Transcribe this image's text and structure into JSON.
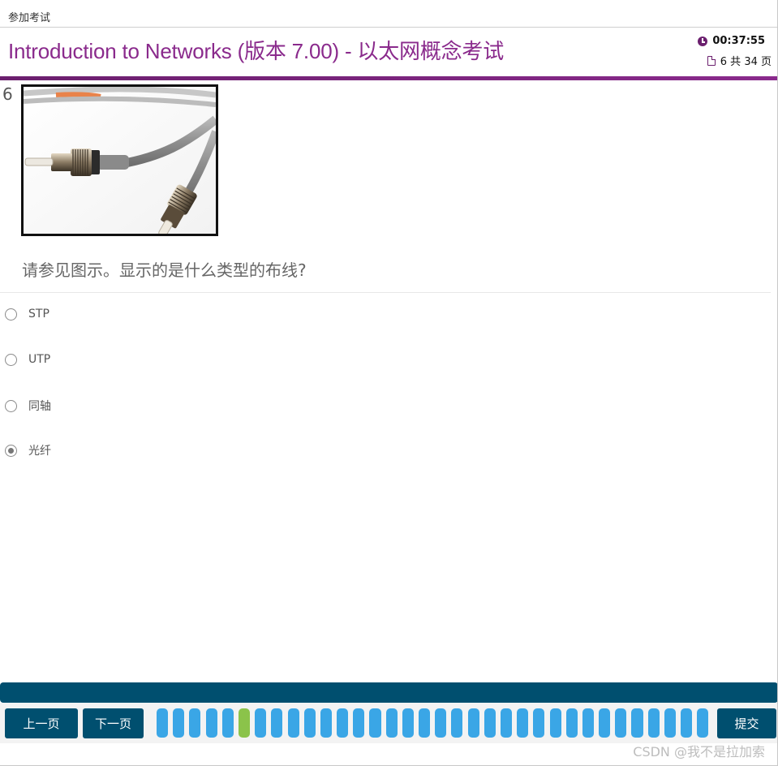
{
  "topbar": {
    "breadcrumb": "参加考试"
  },
  "header": {
    "title": "Introduction to Networks (版本 7.00) - 以太网概念考试",
    "timer": "00:37:55",
    "page_counter": "6 共 34 页",
    "accent_color": "#8a2a8c"
  },
  "question": {
    "number": "6",
    "figure_icon": "fiber-optic-st-connector-photo",
    "text": "请参见图示。显示的是什么类型的布线?",
    "options": [
      {
        "label": "STP",
        "selected": false
      },
      {
        "label": "UTP",
        "selected": false
      },
      {
        "label": "同轴",
        "selected": false
      },
      {
        "label": "光纤",
        "selected": true
      }
    ]
  },
  "nav": {
    "prev_label": "上一页",
    "next_label": "下一页",
    "submit_label": "提交",
    "total_pages": 34,
    "current_page": 6,
    "pip_color": "#3aa6e6",
    "current_pip_color": "#8bc34a",
    "bar_color": "#004f6f"
  },
  "watermark": "CSDN @我不是拉加索"
}
